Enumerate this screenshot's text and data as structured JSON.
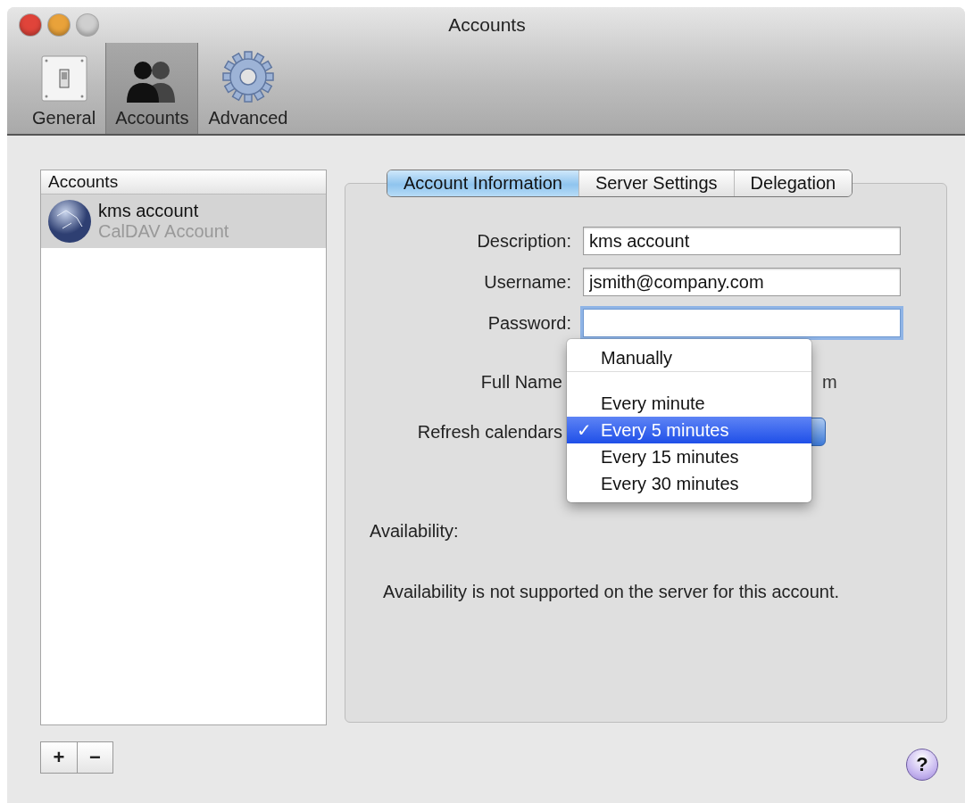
{
  "window": {
    "title": "Accounts"
  },
  "toolbar": [
    {
      "label": "General",
      "kind": "switch",
      "selected": false
    },
    {
      "label": "Accounts",
      "kind": "people",
      "selected": true
    },
    {
      "label": "Advanced",
      "kind": "gear",
      "selected": false
    }
  ],
  "accounts_list": {
    "header": "Accounts",
    "items": [
      {
        "name": "kms account",
        "type": "CalDAV Account",
        "selected": true
      }
    ]
  },
  "tabs": [
    {
      "label": "Account Information",
      "selected": true
    },
    {
      "label": "Server Settings",
      "selected": false
    },
    {
      "label": "Delegation",
      "selected": false
    }
  ],
  "form": [
    {
      "label": "Description:",
      "kind": "text",
      "value": "kms account",
      "focused": false
    },
    {
      "label": "Username:",
      "kind": "text",
      "value": "jsmith@company.com",
      "focused": false
    },
    {
      "label": "Password:",
      "kind": "text",
      "focused": true
    },
    {
      "label": "Full Name",
      "kind": "static",
      "value": "m"
    },
    {
      "label": "Refresh calendars",
      "kind": "popup"
    }
  ],
  "refresh_menu": [
    {
      "label": "Manually",
      "selected": false,
      "separator_after": true
    },
    {
      "label": "Every minute",
      "selected": false,
      "separator_after": false
    },
    {
      "label": "Every 5 minutes",
      "selected": true,
      "separator_after": false
    },
    {
      "label": "Every 15 minutes",
      "selected": false,
      "separator_after": false
    },
    {
      "label": "Every 30 minutes",
      "selected": false,
      "separator_after": false
    }
  ],
  "menu_check": "✓",
  "availability": {
    "label": "Availability:",
    "message": "Availability is not supported on the server for this account."
  },
  "list_buttons": [
    "+",
    "−"
  ],
  "help": "?"
}
